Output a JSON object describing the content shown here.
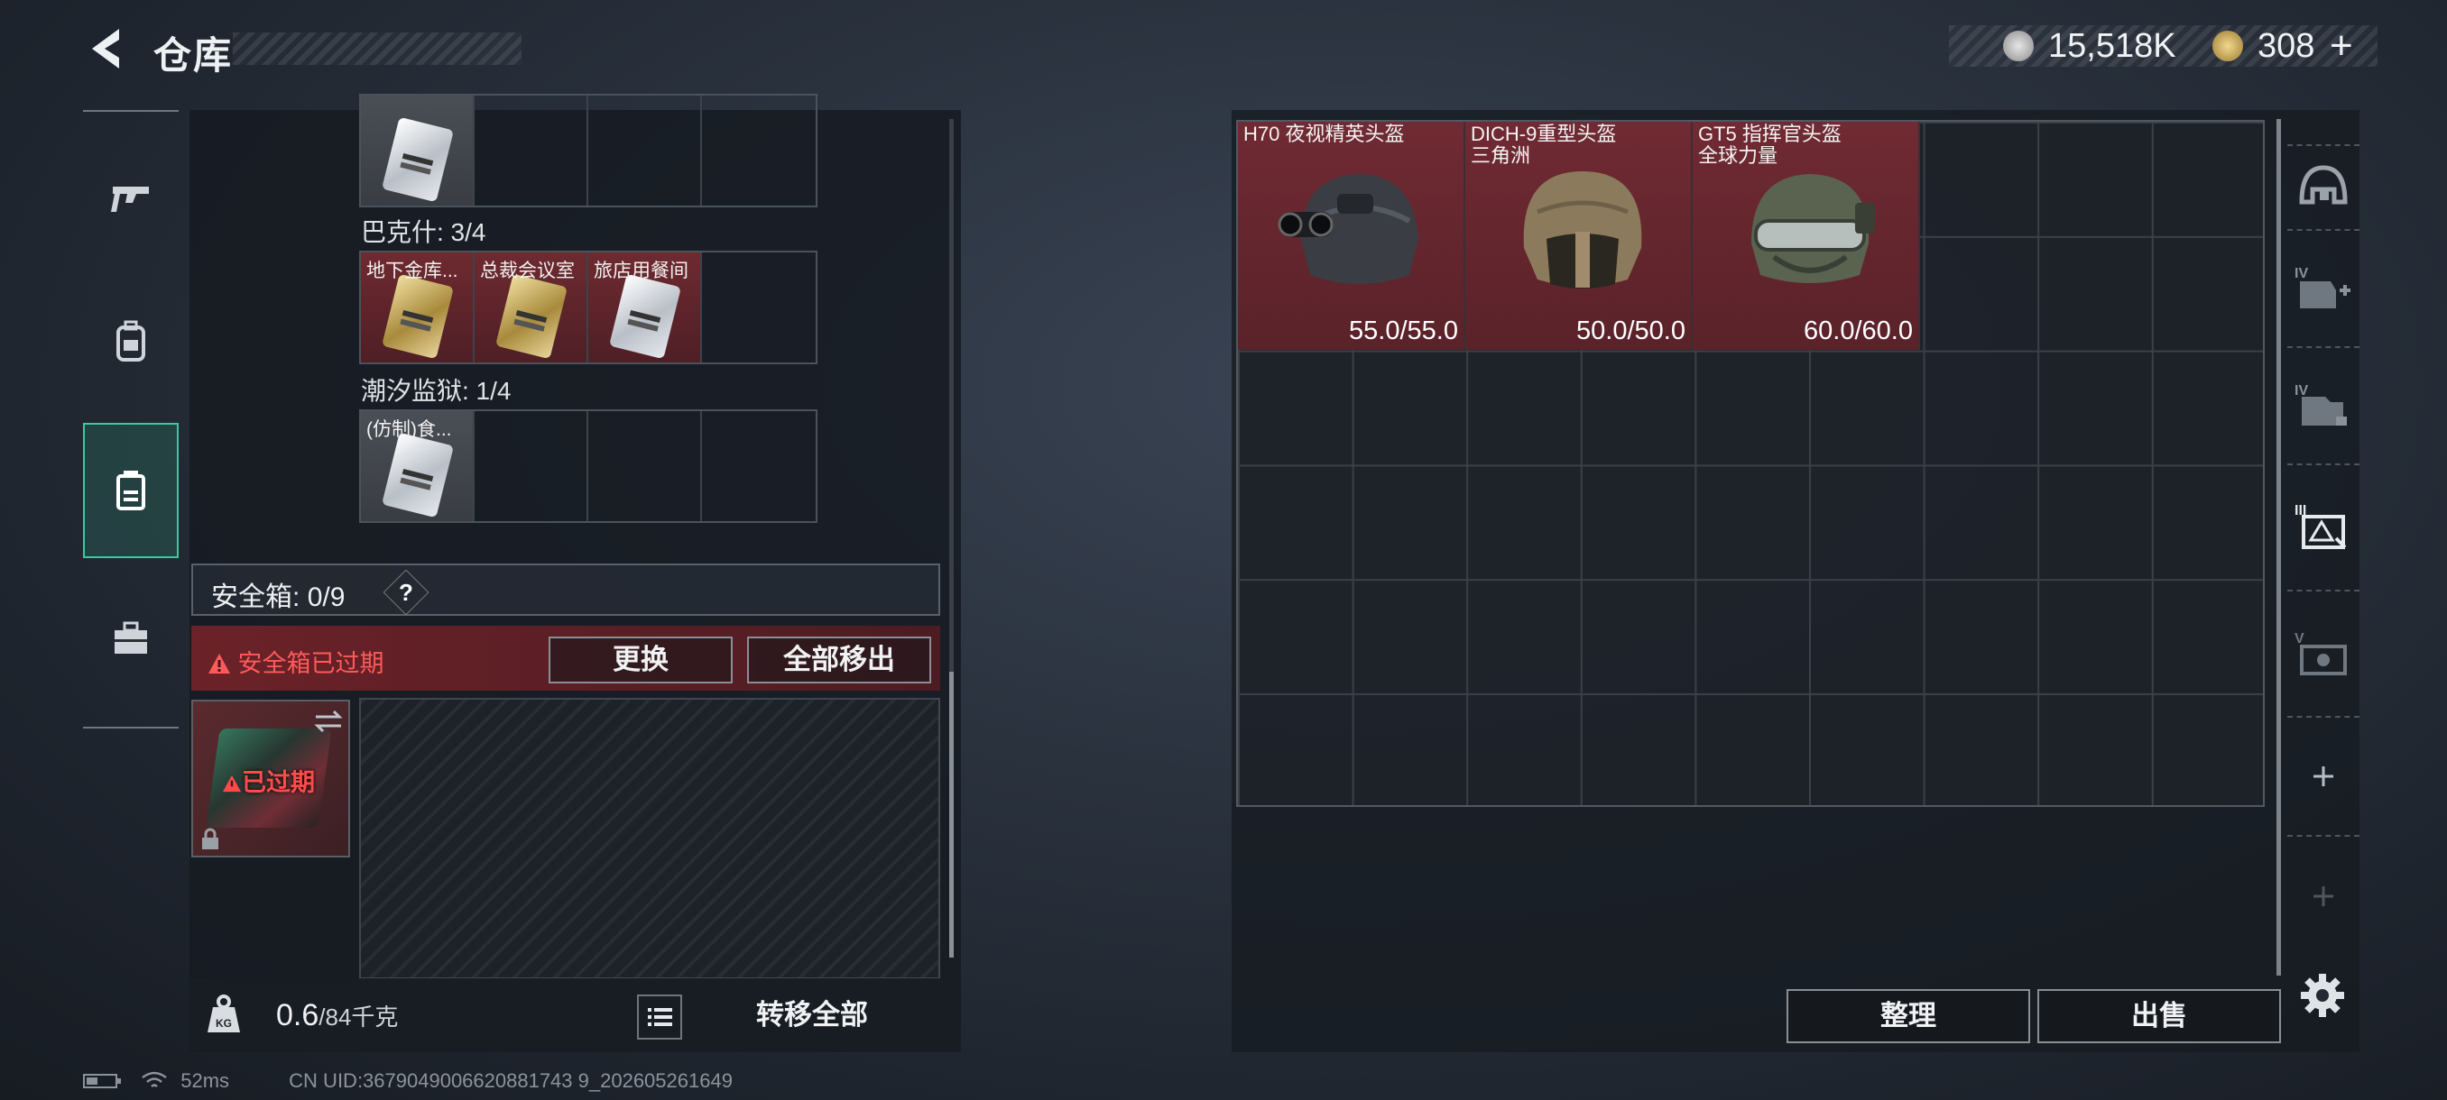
{
  "header": {
    "title": "仓库",
    "currency_silver": "15,518K",
    "currency_gold": "308",
    "currency_gold_add": "+"
  },
  "nav": {
    "items": [
      {
        "name": "weapons-icon",
        "active": false
      },
      {
        "name": "backpack-icon",
        "active": false
      },
      {
        "name": "keycard-icon",
        "active": true
      },
      {
        "name": "toolbox-icon",
        "active": false
      }
    ]
  },
  "keys": {
    "groups": [
      {
        "label": "",
        "cells": [
          {
            "label": "",
            "style": "silver",
            "bg": "gray"
          }
        ]
      },
      {
        "label": "巴克什: 3/4",
        "cells": [
          {
            "label": "地下金库...",
            "style": "gold",
            "bg": "red"
          },
          {
            "label": "总裁会议室",
            "style": "gold",
            "bg": "red"
          },
          {
            "label": "旅店用餐间",
            "style": "silver",
            "bg": "red"
          }
        ]
      },
      {
        "label": "潮汐监狱: 1/4",
        "cells": [
          {
            "label": "(仿制)食...",
            "style": "silver",
            "bg": "gray"
          }
        ]
      }
    ]
  },
  "safebox": {
    "label": "安全箱:",
    "count": "0/9",
    "help": "?",
    "expired_warning": "安全箱已过期",
    "swap_label": "更换",
    "move_all_label": "全部移出",
    "item_status": "已过期"
  },
  "bottom_left": {
    "weight_value": "0.6",
    "weight_capacity": "/84千克",
    "transfer_all_label": "转移全部"
  },
  "footer": {
    "ping": "52ms",
    "uid": "CN UID:3679049006620881743 9_202605261649"
  },
  "stash": {
    "items": [
      {
        "name": "H70 夜视精英头盔",
        "subtitle": "",
        "durability": "55.0/55.0",
        "accent": "#3a3d44"
      },
      {
        "name": "DICH-9重型头盔",
        "subtitle": "三角洲",
        "durability": "50.0/50.0",
        "accent": "#8c7a5c"
      },
      {
        "name": "GT5 指挥官头盔",
        "subtitle": "全球力量",
        "durability": "60.0/60.0",
        "accent": "#5a6250"
      }
    ]
  },
  "right_nav": {
    "items": [
      "helmet-slot-icon",
      "armor-add-icon",
      "chest-rig-icon",
      "keycard-case-icon",
      "storage-case-icon",
      "add-icon",
      "add-icon-disabled"
    ]
  },
  "actions": {
    "sort_label": "整理",
    "sell_label": "出售"
  },
  "colors": {
    "accent_green": "#3ec7a0",
    "item_red": "#702a33",
    "warning_red": "#ff5a5a"
  }
}
